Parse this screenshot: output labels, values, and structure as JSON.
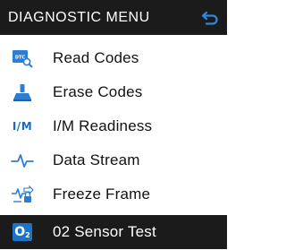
{
  "header": {
    "title": "DIAGNOSTIC MENU",
    "back_icon": "back-arrow-icon"
  },
  "colors": {
    "header_bg": "#1b1b1b",
    "accent_blue": "#1f73c7"
  },
  "menu": {
    "items": [
      {
        "label": "Read Codes",
        "icon": "dtc-search-icon"
      },
      {
        "label": "Erase Codes",
        "icon": "eraser-icon"
      },
      {
        "label": "I/M Readiness",
        "icon": "im-icon",
        "icon_text": "I/M"
      },
      {
        "label": "Data Stream",
        "icon": "waveform-icon"
      },
      {
        "label": "Freeze Frame",
        "icon": "freeze-frame-icon"
      },
      {
        "label": "02 Sensor Test",
        "icon": "o2-sensor-icon",
        "icon_text": "O",
        "icon_sub": "2",
        "selected": true
      }
    ]
  }
}
